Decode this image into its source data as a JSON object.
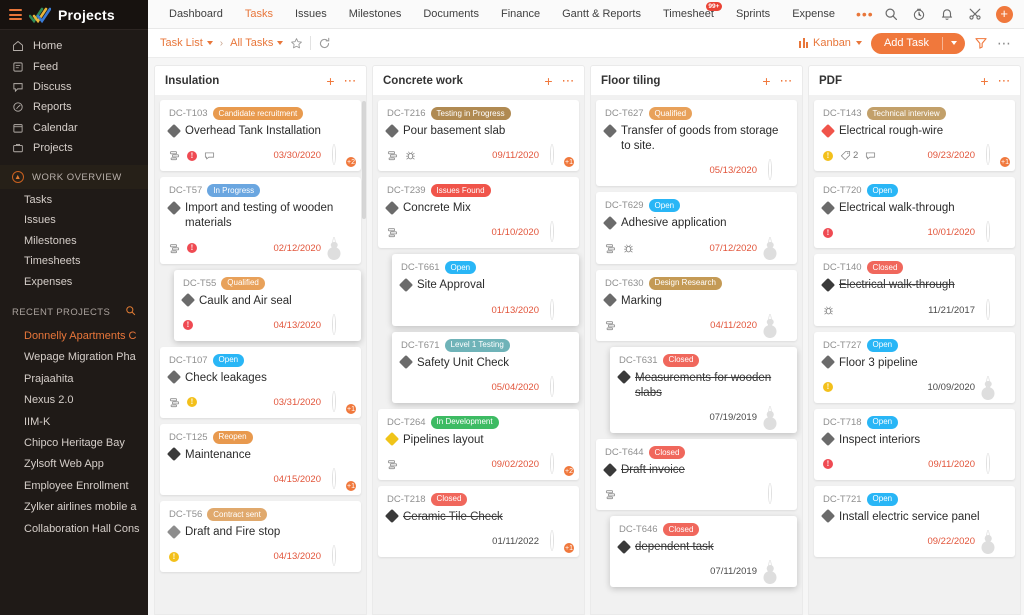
{
  "sidebar": {
    "app_title": "Projects",
    "nav": [
      {
        "label": "Home",
        "icon": "home-icon"
      },
      {
        "label": "Feed",
        "icon": "feed-icon"
      },
      {
        "label": "Discuss",
        "icon": "chat-icon"
      },
      {
        "label": "Reports",
        "icon": "reports-icon"
      },
      {
        "label": "Calendar",
        "icon": "calendar-icon"
      },
      {
        "label": "Projects",
        "icon": "briefcase-icon"
      }
    ],
    "work_overview_label": "WORK OVERVIEW",
    "work_overview": [
      "Tasks",
      "Issues",
      "Milestones",
      "Timesheets",
      "Expenses"
    ],
    "recent_projects_label": "RECENT PROJECTS",
    "recent_projects": [
      {
        "label": "Donnelly Apartments C",
        "active": true
      },
      {
        "label": "Wepage Migration Pha",
        "active": false
      },
      {
        "label": "Prajaahita",
        "active": false
      },
      {
        "label": "Nexus 2.0",
        "active": false
      },
      {
        "label": "IIM-K",
        "active": false
      },
      {
        "label": "Chipco Heritage Bay",
        "active": false
      },
      {
        "label": "Zylsoft Web App",
        "active": false
      },
      {
        "label": "Employee Enrollment",
        "active": false
      },
      {
        "label": "Zylker airlines mobile a",
        "active": false
      },
      {
        "label": "Collaboration Hall Cons",
        "active": false
      }
    ]
  },
  "topbar": {
    "tabs": [
      {
        "label": "Dashboard",
        "active": false,
        "badge": null
      },
      {
        "label": "Tasks",
        "active": true,
        "badge": null
      },
      {
        "label": "Issues",
        "active": false,
        "badge": null
      },
      {
        "label": "Milestones",
        "active": false,
        "badge": null
      },
      {
        "label": "Documents",
        "active": false,
        "badge": null
      },
      {
        "label": "Finance",
        "active": false,
        "badge": null
      },
      {
        "label": "Gantt & Reports",
        "active": false,
        "badge": null
      },
      {
        "label": "Timesheet",
        "active": false,
        "badge": "99+"
      },
      {
        "label": "Sprints",
        "active": false,
        "badge": null
      },
      {
        "label": "Expense",
        "active": false,
        "badge": null
      }
    ],
    "more_label": "•••",
    "icons": [
      "search-icon",
      "timer-icon",
      "bell-icon",
      "tools-icon",
      "add-icon",
      "user-avatar"
    ]
  },
  "toolbar": {
    "breadcrumb_1": "Task List",
    "breadcrumb_sep": "›",
    "breadcrumb_2": "All Tasks",
    "star_icon": "star-icon",
    "refresh_icon": "refresh-icon",
    "view_label": "Kanban",
    "add_task_label": "Add Task",
    "filter_icon": "funnel-icon",
    "more_icon": "more-options-icon",
    "accent_color": "#f0783c"
  },
  "board": {
    "columns": [
      {
        "title": "Insulation",
        "cards": [
          {
            "id": "DC-T103",
            "status": "Candidate recruitment",
            "status_color": "#e89a4e",
            "title": "Overhead Tank Installation",
            "priority_color": "#6b6b6b",
            "date": "03/30/2020",
            "date_style": "red",
            "icons": [
              "subtask-icon",
              "priority-high-icon",
              "comment-icon"
            ],
            "avatar": "dark",
            "avatar_extra": "+2",
            "done": false,
            "dragging": false
          },
          {
            "id": "DC-T57",
            "status": "In Progress",
            "status_color": "#6aa6e0",
            "title": "Import and testing of wooden materials",
            "priority_color": "#6b6b6b",
            "date": "02/12/2020",
            "date_style": "red",
            "icons": [
              "subtask-icon",
              "priority-high-icon"
            ],
            "avatar": "empty",
            "avatar_extra": null,
            "done": false,
            "dragging": false
          },
          {
            "id": "DC-T55",
            "status": "Qualified",
            "status_color": "#e8a15a",
            "title": "Caulk and Air seal",
            "priority_color": "#6b6b6b",
            "date": "04/13/2020",
            "date_style": "red",
            "icons": [
              "priority-high-icon"
            ],
            "avatar": "light",
            "avatar_extra": null,
            "done": false,
            "dragging": true
          },
          {
            "id": "DC-T107",
            "status": "Open",
            "status_color": "#29b6f6",
            "title": "Check leakages",
            "priority_color": "#6b6b6b",
            "date": "03/31/2020",
            "date_style": "red",
            "icons": [
              "subtask-icon",
              "priority-medium-icon"
            ],
            "avatar": "light",
            "avatar_extra": "+1",
            "done": false,
            "dragging": false
          },
          {
            "id": "DC-T125",
            "status": "Reopen",
            "status_color": "#e8994e",
            "title": "Maintenance",
            "priority_color": "#3a3a3a",
            "date": "04/15/2020",
            "date_style": "red",
            "icons": [],
            "avatar": "dark",
            "avatar_extra": "+1",
            "done": false,
            "dragging": false
          },
          {
            "id": "DC-T56",
            "status": "Contract sent",
            "status_color": "#e0a96d",
            "title": "Draft and Fire stop",
            "priority_color": "#8d8d8d",
            "date": "04/13/2020",
            "date_style": "red",
            "icons": [
              "priority-medium-icon"
            ],
            "avatar": "light",
            "avatar_extra": null,
            "done": false,
            "dragging": false
          }
        ]
      },
      {
        "title": "Concrete work",
        "cards": [
          {
            "id": "DC-T216",
            "status": "Testing in Progress",
            "status_color": "#b08a52",
            "title": "Pour basement slab",
            "priority_color": "#6b6b6b",
            "date": "09/11/2020",
            "date_style": "red",
            "icons": [
              "subtask-icon",
              "bug-icon"
            ],
            "avatar": "dark",
            "avatar_extra": "+1",
            "done": false,
            "dragging": false
          },
          {
            "id": "DC-T239",
            "status": "Issues Found",
            "status_color": "#f0544a",
            "title": "Concrete Mix",
            "priority_color": "#6b6b6b",
            "date": "01/10/2020",
            "date_style": "red",
            "icons": [
              "subtask-icon"
            ],
            "avatar": "dark",
            "avatar_extra": null,
            "done": false,
            "dragging": false
          },
          {
            "id": "DC-T661",
            "status": "Open",
            "status_color": "#29b6f6",
            "title": "Site Approval",
            "priority_color": "#6b6b6b",
            "date": "01/13/2020",
            "date_style": "red",
            "icons": [],
            "avatar": "dark",
            "avatar_extra": null,
            "done": false,
            "dragging": true
          },
          {
            "id": "DC-T671",
            "status": "Level 1 Testing",
            "status_color": "#6fb3b8",
            "title": "Safety Unit Check",
            "priority_color": "#6b6b6b",
            "date": "05/04/2020",
            "date_style": "red",
            "icons": [],
            "avatar": "light",
            "avatar_extra": null,
            "done": false,
            "dragging": true
          },
          {
            "id": "DC-T264",
            "status": "In Development",
            "status_color": "#3dbb63",
            "title": "Pipelines layout",
            "priority_color": "#f0c419",
            "date": "09/02/2020",
            "date_style": "red",
            "icons": [
              "subtask-icon"
            ],
            "avatar": "light",
            "avatar_extra": "+2",
            "done": false,
            "dragging": false
          },
          {
            "id": "DC-T218",
            "status": "Closed",
            "status_color": "#f0675c",
            "title": "Ceramic Tile Check",
            "priority_color": "#3a3a3a",
            "date": "01/11/2022",
            "date_style": "grey",
            "icons": [],
            "avatar": "dark",
            "avatar_extra": "+1",
            "done": true,
            "dragging": false
          }
        ]
      },
      {
        "title": "Floor tiling",
        "cards": [
          {
            "id": "DC-T627",
            "status": "Qualified",
            "status_color": "#e8a15a",
            "title": "Transfer of goods from storage to site.",
            "priority_color": "#6b6b6b",
            "date": "05/13/2020",
            "date_style": "red",
            "icons": [],
            "avatar": "light",
            "avatar_extra": null,
            "done": false,
            "dragging": false
          },
          {
            "id": "DC-T629",
            "status": "Open",
            "status_color": "#29b6f6",
            "title": "Adhesive application",
            "priority_color": "#6b6b6b",
            "date": "07/12/2020",
            "date_style": "red",
            "icons": [
              "subtask-icon",
              "bug-icon"
            ],
            "avatar": "empty",
            "avatar_extra": null,
            "done": false,
            "dragging": false
          },
          {
            "id": "DC-T630",
            "status": "Design Research",
            "status_color": "#c49a55",
            "title": "Marking",
            "priority_color": "#6b6b6b",
            "date": "04/11/2020",
            "date_style": "red",
            "icons": [
              "subtask-icon"
            ],
            "avatar": "empty",
            "avatar_extra": null,
            "done": false,
            "dragging": false
          },
          {
            "id": "DC-T631",
            "status": "Closed",
            "status_color": "#f0675c",
            "title": "Measurements for wooden slabs",
            "priority_color": "#3a3a3a",
            "date": "07/19/2019",
            "date_style": "grey",
            "icons": [],
            "avatar": "empty",
            "avatar_extra": null,
            "done": true,
            "dragging": true
          },
          {
            "id": "DC-T644",
            "status": "Closed",
            "status_color": "#f0675c",
            "title": "Draft invoice",
            "priority_color": "#3a3a3a",
            "date": "",
            "date_style": "grey",
            "icons": [
              "subtask-icon"
            ],
            "avatar": "dark",
            "avatar_extra": null,
            "done": true,
            "dragging": false
          },
          {
            "id": "DC-T646",
            "status": "Closed",
            "status_color": "#f0675c",
            "title": "dependent task",
            "priority_color": "#3a3a3a",
            "date": "07/11/2019",
            "date_style": "grey",
            "icons": [],
            "avatar": "empty",
            "avatar_extra": null,
            "done": true,
            "dragging": true
          }
        ]
      },
      {
        "title": "PDF",
        "cards": [
          {
            "id": "DC-T143",
            "status": "Technical interview",
            "status_color": "#c2a06a",
            "title": "Electrical rough-wire",
            "priority_color": "#f0544a",
            "date": "09/23/2020",
            "date_style": "red",
            "icons": [
              "priority-medium-icon",
              "tag-icon",
              "comment-icon"
            ],
            "tag_count": "2",
            "avatar": "dark",
            "avatar_extra": "+1",
            "done": false,
            "dragging": false
          },
          {
            "id": "DC-T720",
            "status": "Open",
            "status_color": "#29b6f6",
            "title": "Electrical walk-through",
            "priority_color": "#6b6b6b",
            "date": "10/01/2020",
            "date_style": "red",
            "icons": [
              "priority-high-icon"
            ],
            "avatar": "light",
            "avatar_extra": null,
            "done": false,
            "dragging": false
          },
          {
            "id": "DC-T140",
            "status": "Closed",
            "status_color": "#f0675c",
            "title": "Electrical walk-through",
            "priority_color": "#3a3a3a",
            "date": "11/21/2017",
            "date_style": "grey",
            "icons": [
              "bug-icon"
            ],
            "avatar": "light",
            "avatar_extra": null,
            "done": true,
            "dragging": false
          },
          {
            "id": "DC-T727",
            "status": "Open",
            "status_color": "#29b6f6",
            "title": "Floor 3 pipeline",
            "priority_color": "#6b6b6b",
            "date": "10/09/2020",
            "date_style": "grey",
            "icons": [
              "priority-medium-icon"
            ],
            "avatar": "empty",
            "avatar_extra": null,
            "done": false,
            "dragging": false
          },
          {
            "id": "DC-T718",
            "status": "Open",
            "status_color": "#29b6f6",
            "title": "Inspect interiors",
            "priority_color": "#6b6b6b",
            "date": "09/11/2020",
            "date_style": "red",
            "icons": [
              "priority-high-icon"
            ],
            "avatar": "light",
            "avatar_extra": null,
            "done": false,
            "dragging": false
          },
          {
            "id": "DC-T721",
            "status": "Open",
            "status_color": "#29b6f6",
            "title": "Install electric service panel",
            "priority_color": "#6b6b6b",
            "date": "09/22/2020",
            "date_style": "red",
            "icons": [],
            "avatar": "empty",
            "avatar_extra": null,
            "done": false,
            "dragging": false
          }
        ]
      }
    ]
  }
}
